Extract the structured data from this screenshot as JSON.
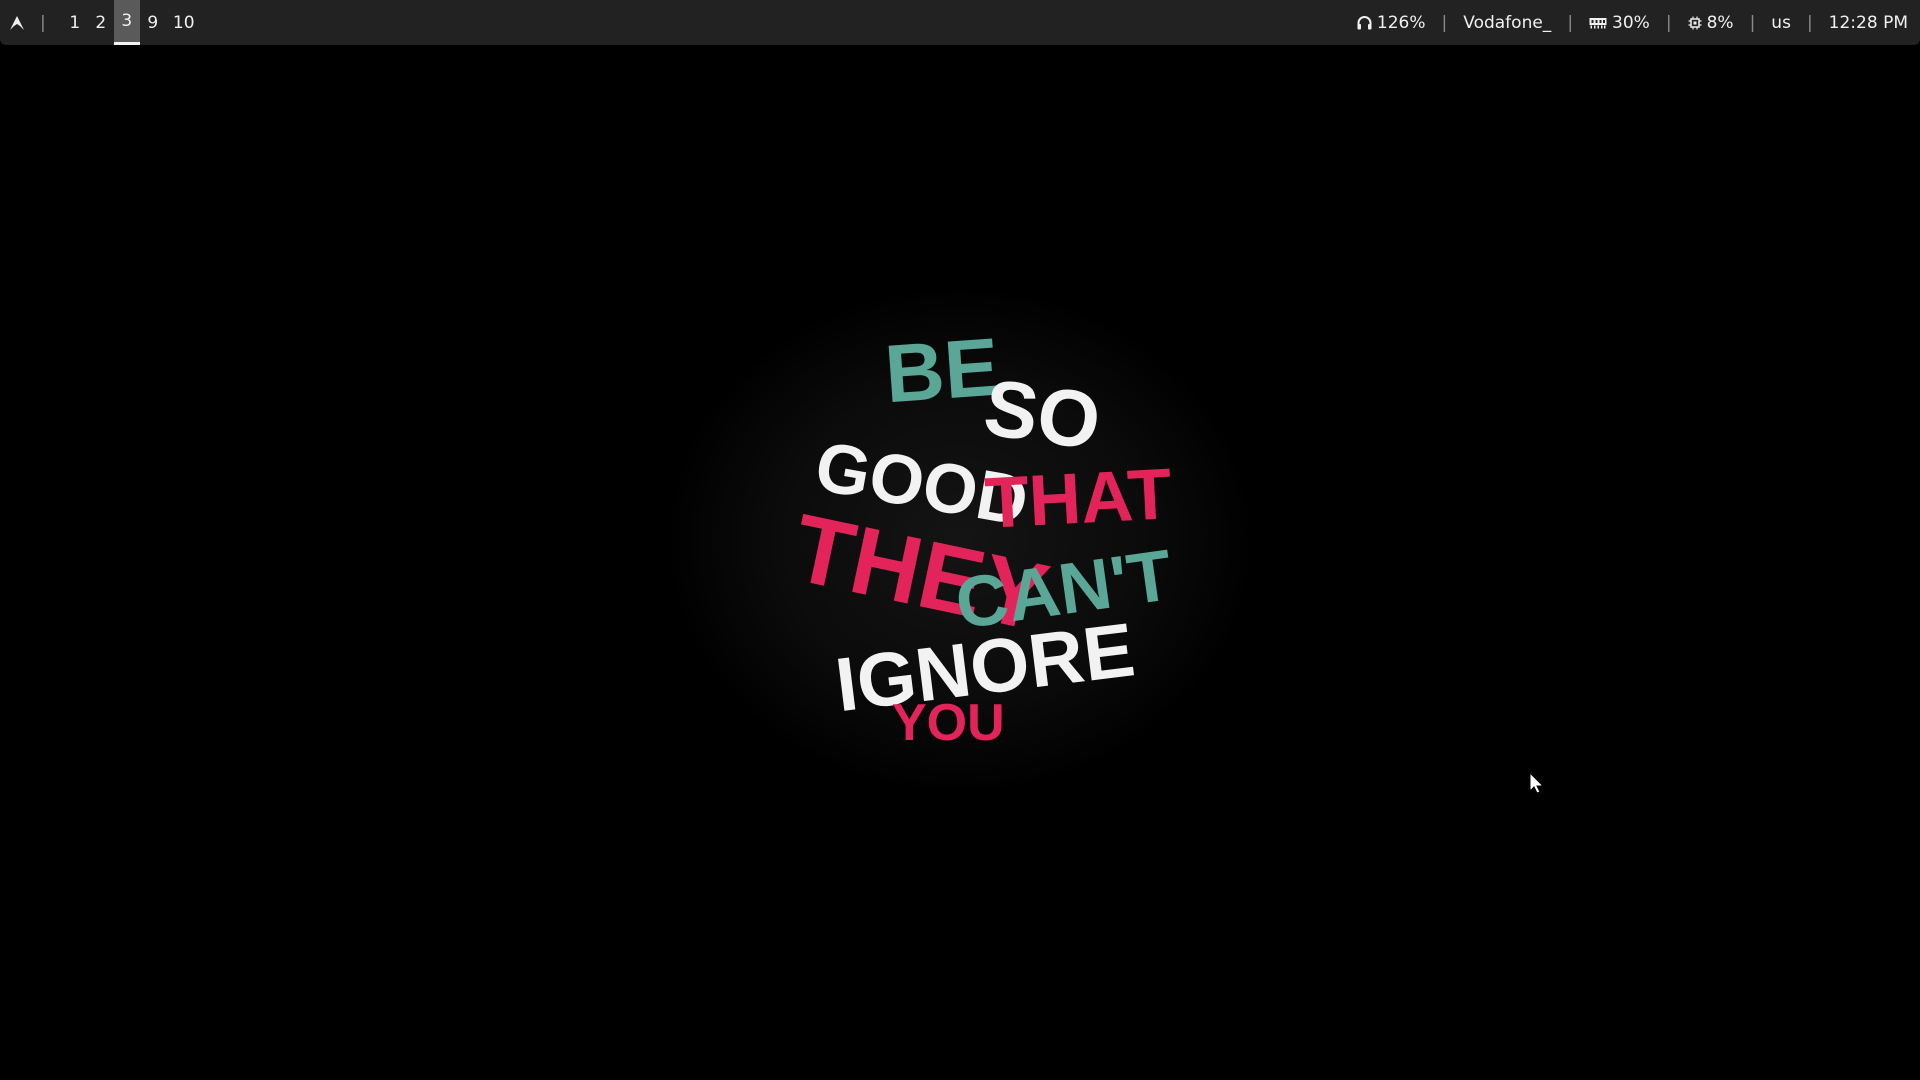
{
  "bar": {
    "workspaces": [
      {
        "label": "1",
        "active": false
      },
      {
        "label": "2",
        "active": false
      },
      {
        "label": "3",
        "active": true
      },
      {
        "label": "9",
        "active": false
      },
      {
        "label": "10",
        "active": false
      }
    ],
    "separator": "|",
    "volume": {
      "icon": "headphones-icon",
      "value": "126%"
    },
    "network": {
      "value": "Vodafone_"
    },
    "memory": {
      "icon": "memory-icon",
      "value": "30%"
    },
    "cpu": {
      "icon": "cpu-icon",
      "value": "8%"
    },
    "keyboard_layout": "us",
    "clock": "12:28 PM"
  },
  "wallpaper": {
    "lines": [
      "BE",
      "SO",
      "GOOD",
      "THAT",
      "THEY",
      "CAN'T",
      "IGNORE",
      "YOU"
    ]
  },
  "colors": {
    "bar_bg": "#222222",
    "active_workspace": "#5a5a5a",
    "teal": "#5aa797",
    "pink": "#e3245a",
    "white": "#f2f2f2"
  }
}
